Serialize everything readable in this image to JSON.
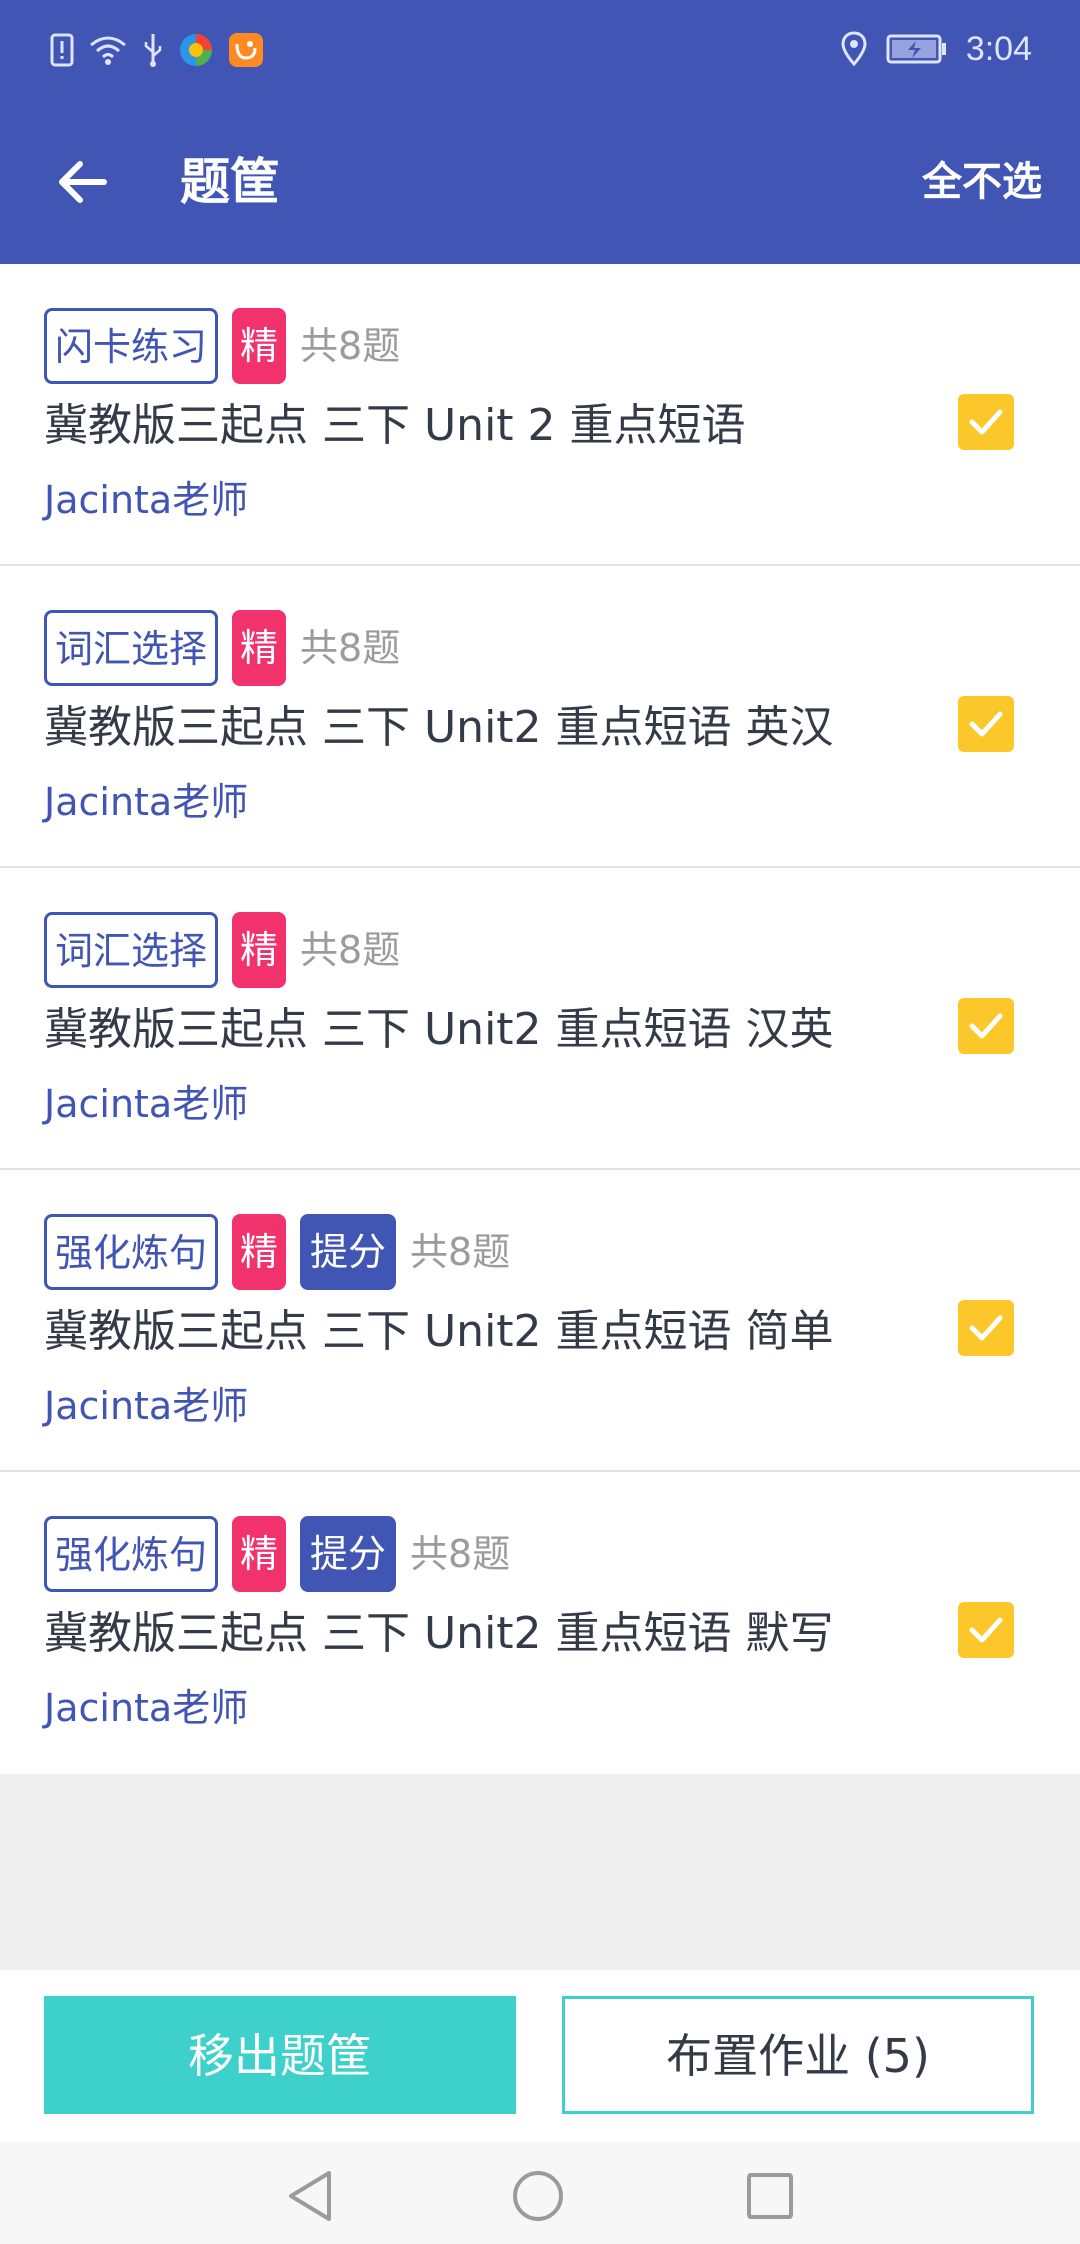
{
  "status_bar": {
    "time": "3:04",
    "icons": [
      "alert-icon",
      "wifi-icon",
      "usb-icon",
      "browser-app-icon",
      "uc-app-icon",
      "location-icon",
      "battery-icon"
    ]
  },
  "header": {
    "title": "题筐",
    "deselect_all": "全不选",
    "back_icon": "arrow-left-icon"
  },
  "items": [
    {
      "type_tag": "闪卡练习",
      "featured_tag": "精",
      "count": "共8题",
      "title": "冀教版三起点 三下 Unit 2 重点短语",
      "teacher": "Jacinta老师",
      "checked": true
    },
    {
      "type_tag": "词汇选择",
      "featured_tag": "精",
      "count": "共8题",
      "title": "冀教版三起点 三下 Unit2 重点短语 英汉",
      "teacher": "Jacinta老师",
      "checked": true
    },
    {
      "type_tag": "词汇选择",
      "featured_tag": "精",
      "count": "共8题",
      "title": "冀教版三起点 三下 Unit2 重点短语 汉英",
      "teacher": "Jacinta老师",
      "checked": true
    },
    {
      "type_tag": "强化炼句",
      "featured_tag": "精",
      "boost_tag": "提分",
      "count": "共8题",
      "title": "冀教版三起点 三下 Unit2 重点短语 简单",
      "teacher": "Jacinta老师",
      "checked": true
    },
    {
      "type_tag": "强化炼句",
      "featured_tag": "精",
      "boost_tag": "提分",
      "count": "共8题",
      "title": "冀教版三起点 三下 Unit2 重点短语 默写",
      "teacher": "Jacinta老师",
      "checked": true
    }
  ],
  "footer": {
    "remove_label": "移出题筐",
    "assign_label": "布置作业 (5)"
  },
  "nav": {
    "back": "triangle-back-icon",
    "home": "circle-home-icon",
    "recents": "square-recents-icon"
  },
  "colors": {
    "primary": "#4155b4",
    "accent_teal": "#3ed1cb",
    "pink": "#f1326c",
    "checkbox": "#fbc72b"
  }
}
